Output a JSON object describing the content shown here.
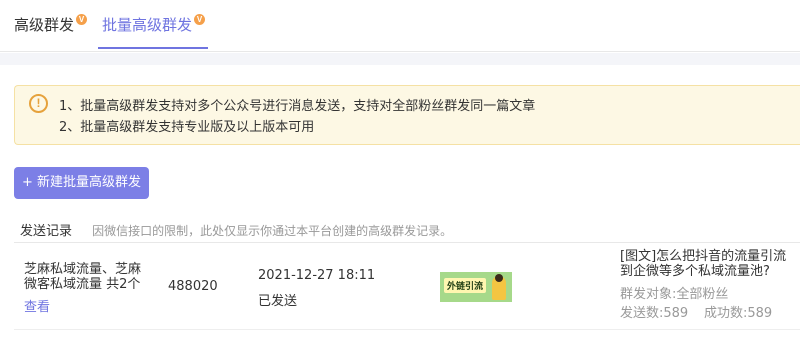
{
  "tabs": [
    {
      "label": "高级群发",
      "badge": "V"
    },
    {
      "label": "批量高级群发",
      "badge": "V",
      "active": true
    }
  ],
  "notice": {
    "line1": "1、批量高级群发支持对多个公众号进行消息发送，支持对全部粉丝群发同一篇文章",
    "line2": "2、批量高级群发支持专业版及以上版本可用"
  },
  "new_button": "+ 新建批量高级群发",
  "records": {
    "title": "发送记录",
    "note": "因微信接口的限制，此处仅显示你通过本平台创建的高级群发记录。"
  },
  "row": {
    "accounts_line1": "芝麻私域流量、芝麻",
    "accounts_line2": "微客私域流量 共2个",
    "view": "查看",
    "msg_id": "488020",
    "time": "2021-12-27 18:11",
    "status": "已发送",
    "thumb_text": "外链引流",
    "article_line1": "[图文]怎么把抖音的流量引流",
    "article_line2": "到企微等多个私域流量池?",
    "target": "群发对象:全部粉丝",
    "sent": "发送数:589",
    "success": "成功数:589"
  },
  "colors": {
    "accent": "#6f74e0",
    "button": "#7c7fe6",
    "warning": "#e6a23c",
    "badge": "#f5a04a"
  }
}
